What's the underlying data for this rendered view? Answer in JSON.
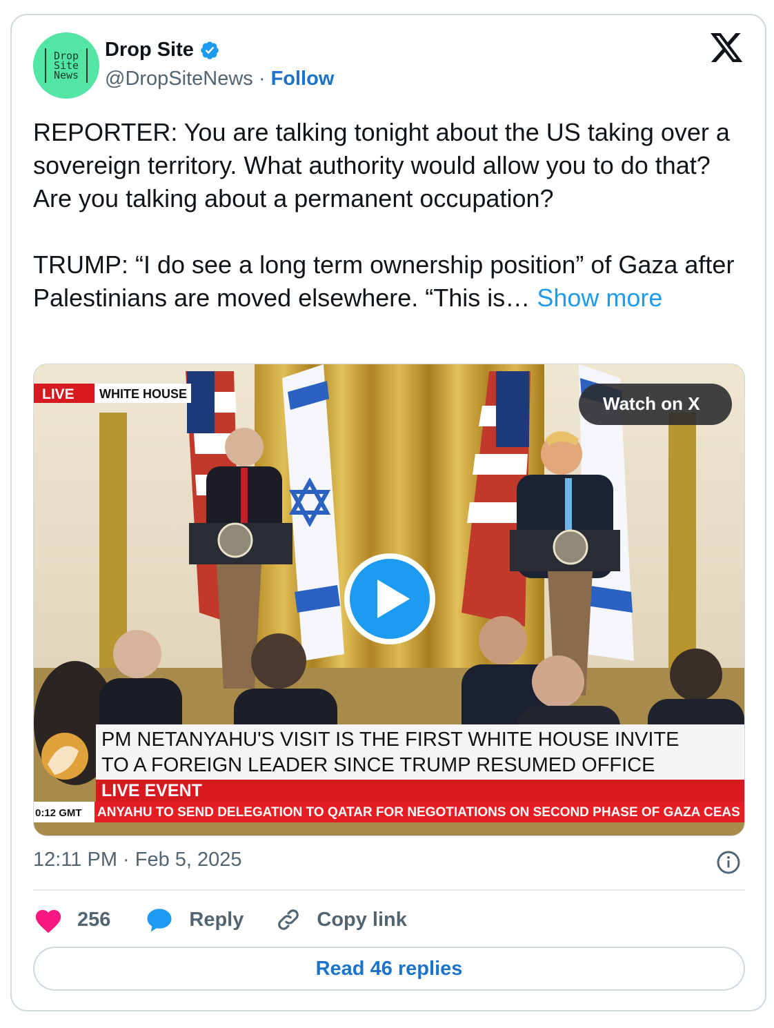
{
  "author": {
    "avatar_lines": [
      "Drop",
      "Site",
      "News"
    ],
    "name": "Drop Site",
    "handle": "@DropSiteNews",
    "separator": " · ",
    "follow_label": "Follow"
  },
  "tweet": {
    "paragraph_1": "REPORTER: You are talking tonight about the US taking over a sovereign territory. What authority would allow you to do that? Are you talking about a permanent occupation?",
    "paragraph_2": "TRUMP: “I do see a long term ownership position” of Gaza after Palestinians are moved elsewhere. “This is… ",
    "show_more": "Show more"
  },
  "video": {
    "live_label": "LIVE",
    "location_label": "WHITE HOUSE",
    "watch_label": "Watch on X",
    "headline_line_1": "PM NETANYAHU'S VISIT IS THE FIRST WHITE HOUSE INVITE",
    "headline_line_2": "TO A FOREIGN LEADER SINCE TRUMP RESUMED OFFICE",
    "event_label": "LIVE EVENT",
    "clock": "0:12 GMT",
    "ticker": "ANYAHU TO SEND DELEGATION TO QATAR FOR NEGOTIATIONS ON SECOND PHASE OF GAZA CEAS"
  },
  "meta": {
    "timestamp": "12:11 PM · Feb 5, 2025"
  },
  "actions": {
    "like_count": "256",
    "reply_label": "Reply",
    "copy_label": "Copy link",
    "read_replies_label": "Read 46 replies"
  },
  "colors": {
    "link": "#1d9bf0",
    "follow": "#1d73c9",
    "heart": "#f91880",
    "reply_bubble": "#1d9bf0",
    "avatar_bg": "#52e5a3",
    "live_red": "#d71920"
  }
}
